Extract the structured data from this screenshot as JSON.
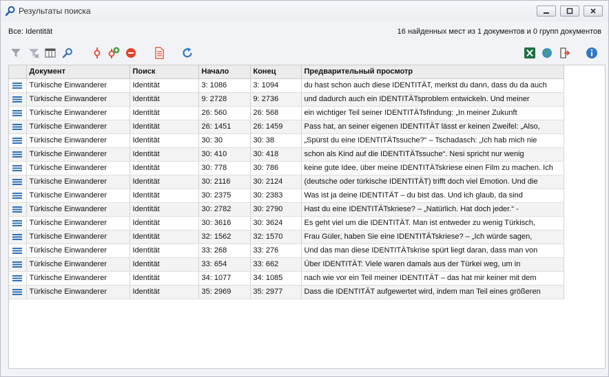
{
  "window": {
    "title": "Результаты поиска"
  },
  "info": {
    "scope": "Все: Identität",
    "summary": "16 найденных мест из 1 документов и 0 групп документов"
  },
  "toolbar": {
    "filter": "filter-icon",
    "filter_off": "filter-clear-icon",
    "columns": "columns-icon",
    "search": "search-icon",
    "code": "code-icon",
    "code_add": "code-add-icon",
    "remove": "remove-icon",
    "doc": "document-icon",
    "refresh": "refresh-icon",
    "excel": "excel-export-icon",
    "web": "web-export-icon",
    "export": "export-icon",
    "info": "info-icon"
  },
  "columns": [
    "",
    "Документ",
    "Поиск",
    "Начало",
    "Конец",
    "Предварительный просмотр"
  ],
  "rows": [
    {
      "doc": "Türkische Einwanderer",
      "search": "Identität",
      "start": "3: 1086",
      "end": "3: 1094",
      "preview": "du   hast schon auch diese IDENTITÄT, merkst du dann, dass du da auch"
    },
    {
      "doc": "Türkische Einwanderer",
      "search": "Identität",
      "start": "9: 2728",
      "end": "9: 2736",
      "preview": "und   dadurch auch ein IDENTITÄTsproblem entwickeln. Und meiner"
    },
    {
      "doc": "Türkische Einwanderer",
      "search": "Identität",
      "start": "26: 560",
      "end": "26: 568",
      "preview": "ein wichtiger Teil seiner IDENTITÄTsfindung: „In meiner Zukunft"
    },
    {
      "doc": "Türkische Einwanderer",
      "search": "Identität",
      "start": "26: 1451",
      "end": "26: 1459",
      "preview": "Pass hat, an seiner eigenen IDENTITÄT lässt er keinen Zweifel: „Also,"
    },
    {
      "doc": "Türkische Einwanderer",
      "search": "Identität",
      "start": "30: 30",
      "end": "30: 38",
      "preview": "„Spürst du eine IDENTITÄTssuche?“ – Tschadasch: „Ich hab mich nie"
    },
    {
      "doc": "Türkische Einwanderer",
      "search": "Identität",
      "start": "30: 410",
      "end": "30: 418",
      "preview": "schon als Kind auf   die IDENTITÄTssuche“.   Nesi spricht nur wenig"
    },
    {
      "doc": "Türkische Einwanderer",
      "search": "Identität",
      "start": "30: 778",
      "end": "30: 786",
      "preview": "keine gute Idee, über meine IDENTITÄTskriese einen Film zu machen. Ich"
    },
    {
      "doc": "Türkische Einwanderer",
      "search": "Identität",
      "start": "30: 2116",
      "end": "30: 2124",
      "preview": "(deutsche oder türkische IDENTITÄT) trifft doch viel Emotion. Und die"
    },
    {
      "doc": "Türkische Einwanderer",
      "search": "Identität",
      "start": "30: 2375",
      "end": "30: 2383",
      "preview": "Was ist ja deine   IDENTITÄT – du bist das. Und ich glaub, da sind"
    },
    {
      "doc": "Türkische Einwanderer",
      "search": "Identität",
      "start": "30: 2782",
      "end": "30: 2790",
      "preview": "Hast   du eine IDENTITÄTskriese? – „Natürlich. Hat doch jeder.“ -"
    },
    {
      "doc": "Türkische Einwanderer",
      "search": "Identität",
      "start": "30: 3616",
      "end": "30: 3624",
      "preview": "Es geht viel um die IDENTITÄT.   Man ist entweder zu wenig Türkisch,"
    },
    {
      "doc": "Türkische Einwanderer",
      "search": "Identität",
      "start": "32: 1562",
      "end": "32: 1570",
      "preview": "Frau Güler, haben Sie eine IDENTITÄTskriese? – „Ich würde sagen,"
    },
    {
      "doc": "Türkische Einwanderer",
      "search": "Identität",
      "start": "33: 268",
      "end": "33: 276",
      "preview": "Und das man diese IDENTITÄTskrise spürt liegt   daran, dass man von"
    },
    {
      "doc": "Türkische Einwanderer",
      "search": "Identität",
      "start": "33: 654",
      "end": "33: 662",
      "preview": "Über IDENTITÄT: Viele waren damals aus der Türkei weg, um in"
    },
    {
      "doc": "Türkische Einwanderer",
      "search": "Identität",
      "start": "34: 1077",
      "end": "34: 1085",
      "preview": "nach wie vor ein Teil meiner IDENTITÄT – das   hat mir keiner mit dem"
    },
    {
      "doc": "Türkische Einwanderer",
      "search": "Identität",
      "start": "35: 2969",
      "end": "35: 2977",
      "preview": "Dass die IDENTITÄT aufgewertet wird, indem man Teil eines größeren"
    }
  ]
}
